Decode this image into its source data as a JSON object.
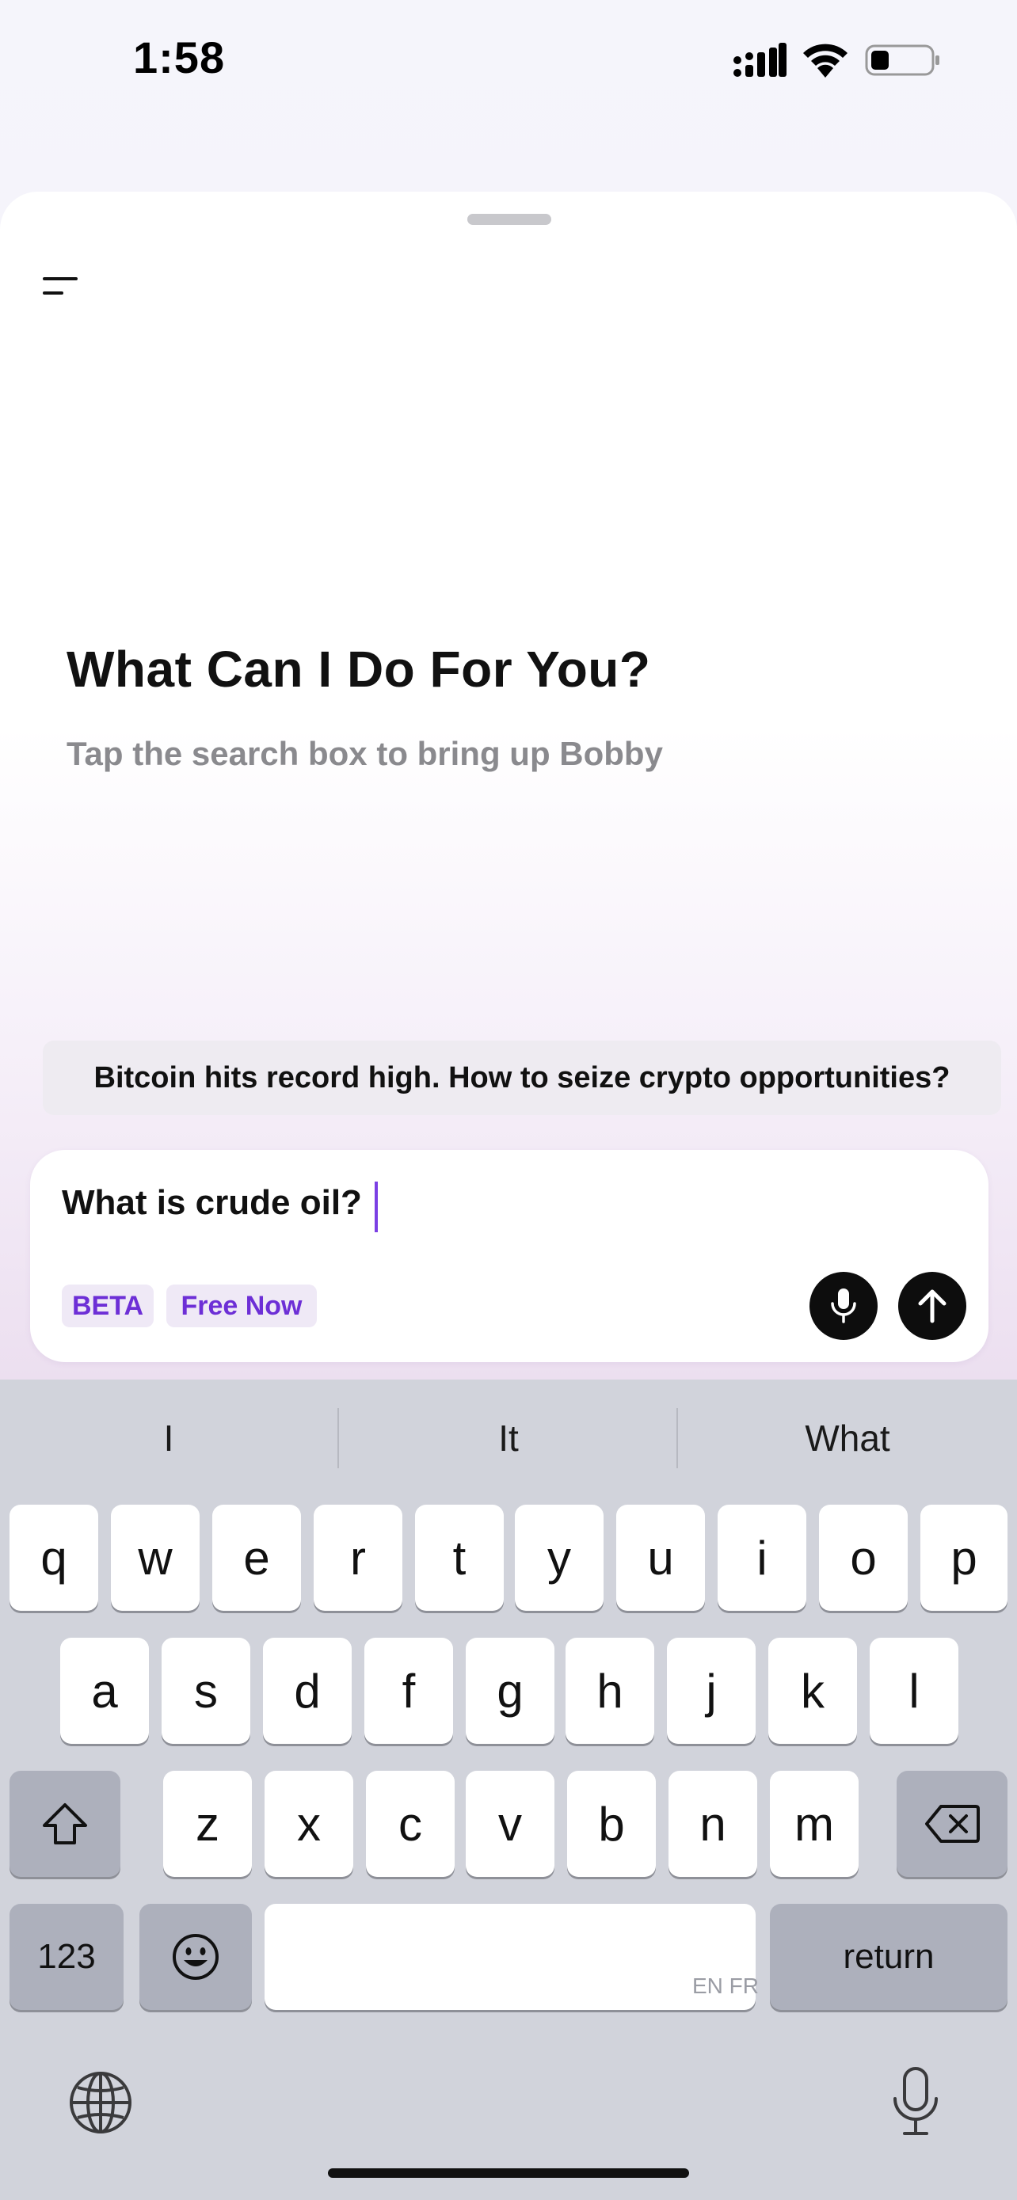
{
  "status_bar": {
    "time": "1:58"
  },
  "main": {
    "headline": "What Can I Do For You?",
    "subline": "Tap the search box to bring up Bobby",
    "suggestion": "Bitcoin hits record high. How to seize crypto opportunities?"
  },
  "composer": {
    "input_value": "What is crude oil?",
    "tags": [
      "BETA",
      "Free Now"
    ]
  },
  "keyboard": {
    "predictions": [
      "I",
      "It",
      "What"
    ],
    "row1": [
      "q",
      "w",
      "e",
      "r",
      "t",
      "y",
      "u",
      "i",
      "o",
      "p"
    ],
    "row2": [
      "a",
      "s",
      "d",
      "f",
      "g",
      "h",
      "j",
      "k",
      "l"
    ],
    "row3": [
      "z",
      "x",
      "c",
      "v",
      "b",
      "n",
      "m"
    ],
    "numbers_label": "123",
    "return_label": "return",
    "space_hint": "EN FR"
  },
  "colors": {
    "accent": "#6d2fd6",
    "caret": "#7b3fe4",
    "keyboard_bg": "#d1d3db"
  },
  "icons": [
    "signal-icon",
    "wifi-icon",
    "battery-icon",
    "menu-icon",
    "microphone-icon",
    "arrow-up-icon",
    "shift-icon",
    "delete-icon",
    "emoji-icon",
    "globe-icon"
  ]
}
